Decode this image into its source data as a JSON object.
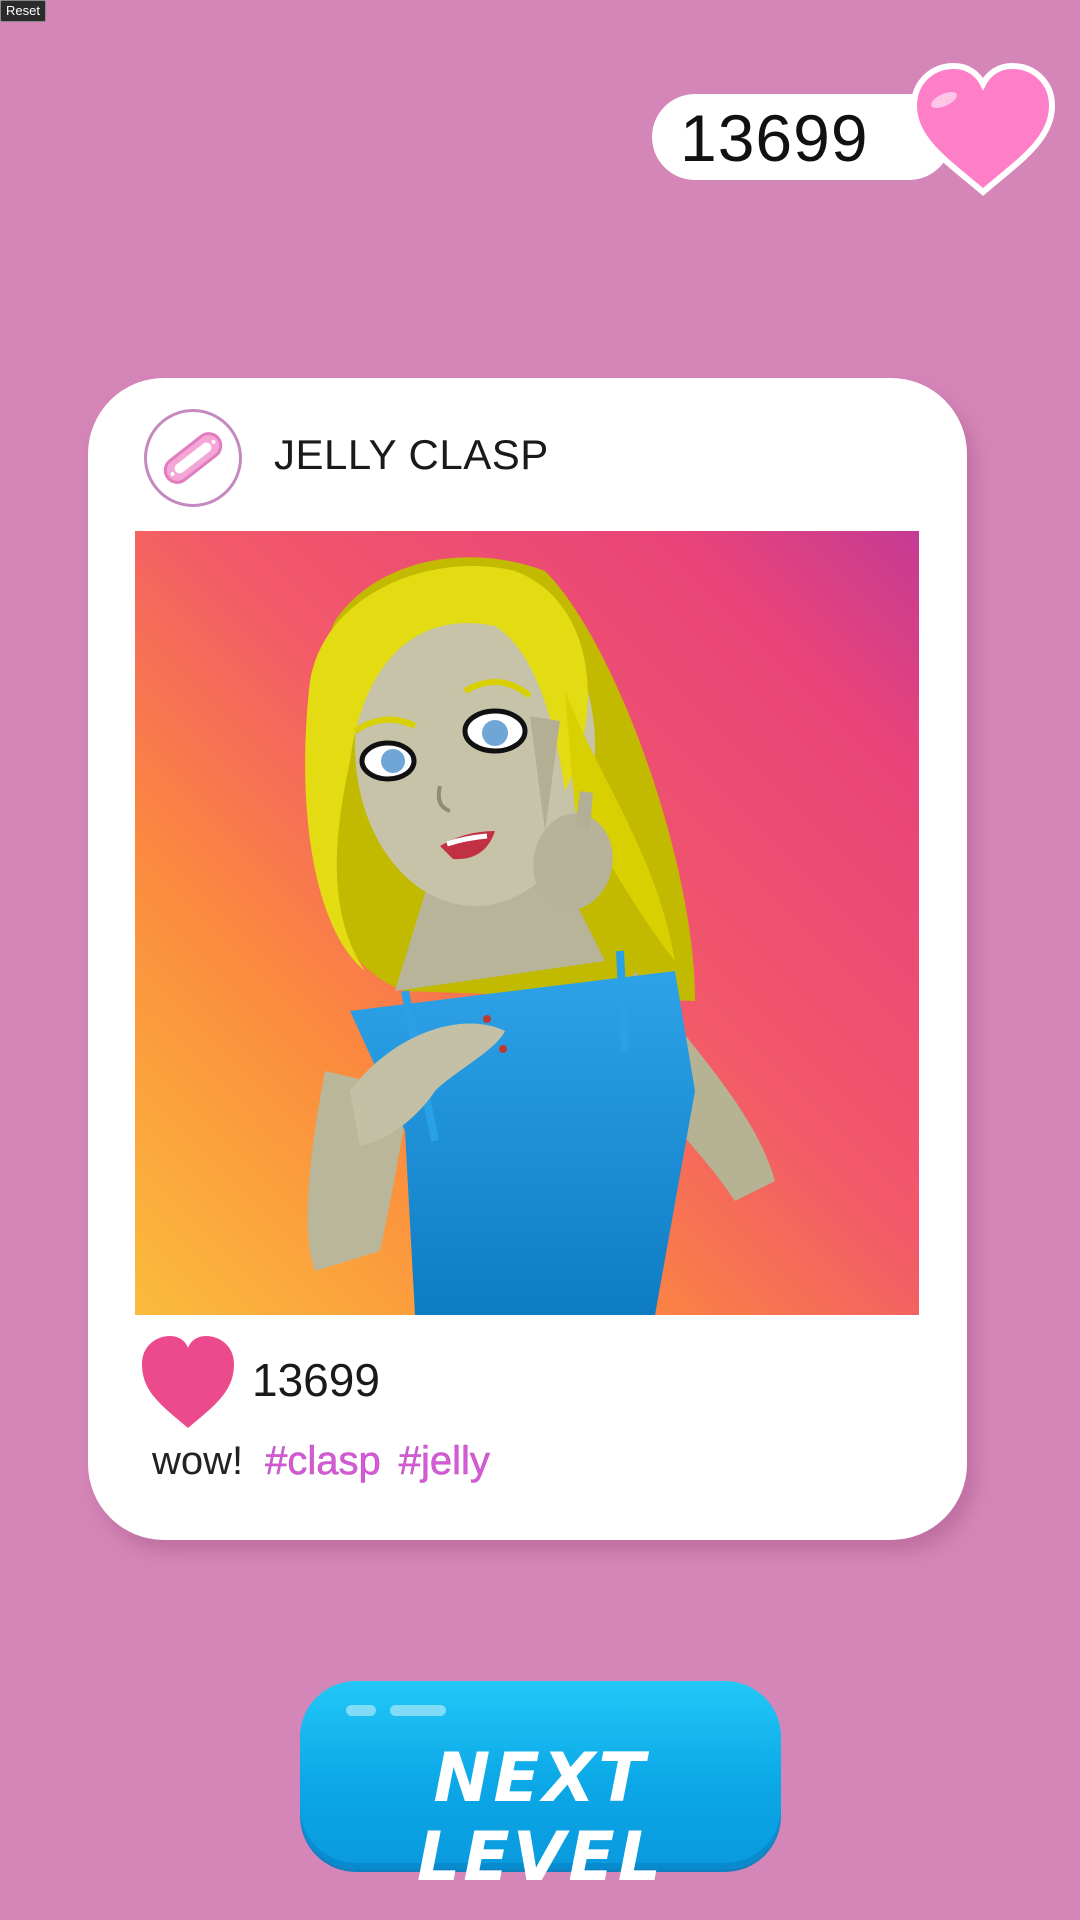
{
  "debug": {
    "reset_label": "Reset"
  },
  "hud": {
    "score": "13699",
    "score_icon": "heart-icon",
    "heart_color": "#ff7ec8"
  },
  "post": {
    "username": "JELLY CLASP",
    "avatar_icon": "jelly-clasp-icon",
    "photo_description_icon": "character-photo",
    "likes": "13699",
    "like_icon": "heart-icon",
    "like_color": "#eb4b8c",
    "caption_word": "wow!",
    "hashtags": [
      "#clasp",
      "#jelly"
    ]
  },
  "next_button": {
    "label": "NEXT LEVEL",
    "color": "#0ba7e7"
  },
  "colors": {
    "background": "#d586b8",
    "card": "#ffffff",
    "hashtag": "#d55bd6"
  }
}
